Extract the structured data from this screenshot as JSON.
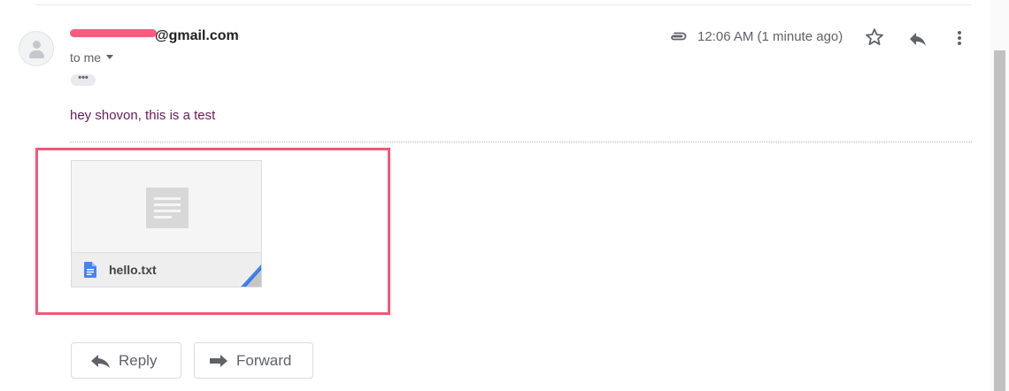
{
  "email": {
    "sender_domain": "@gmail.com",
    "to_line": "to me",
    "show_trimmed": "•••",
    "body": "hey shovon, this is a test",
    "time": "12:06 AM (1 minute ago)"
  },
  "attachment": {
    "filename": "hello.txt",
    "accent_color": "#4285f4"
  },
  "actions": {
    "reply_label": "Reply",
    "forward_label": "Forward"
  },
  "icons": [
    "paperclip-icon",
    "star-icon",
    "reply-icon",
    "more-vert-icon",
    "document-icon",
    "forward-icon"
  ],
  "colors": {
    "highlight": "#f0587a",
    "redaction": "#f45d7d",
    "body_text": "#6a1b5a"
  }
}
